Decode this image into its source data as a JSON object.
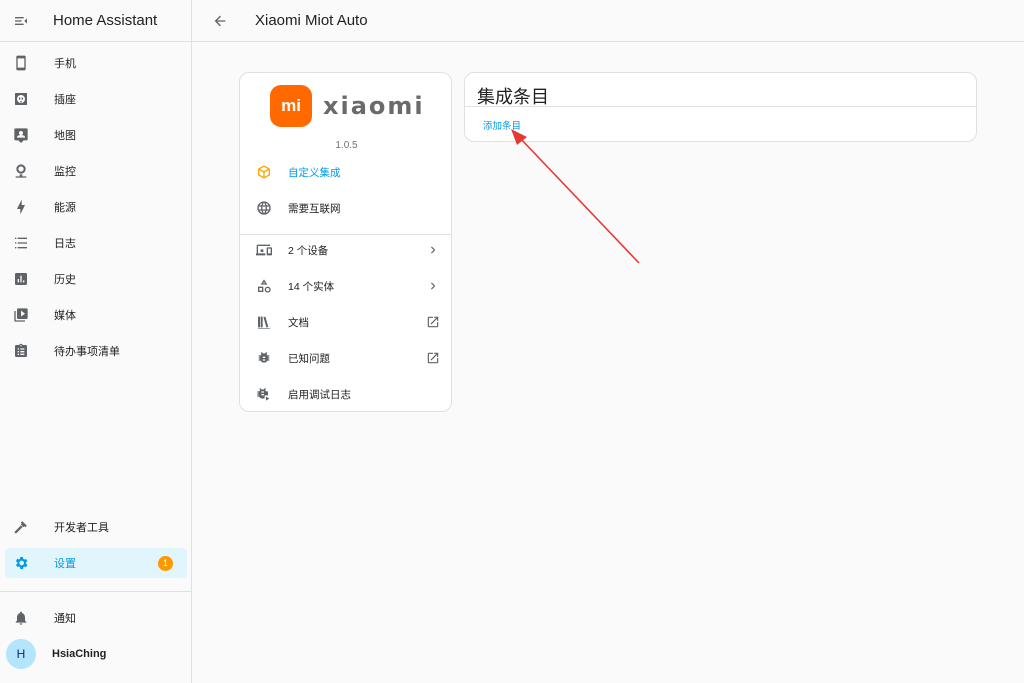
{
  "sidebar": {
    "app_title": "Home Assistant",
    "items": [
      {
        "label": "手机",
        "icon": "phone-icon"
      },
      {
        "label": "插座",
        "icon": "power-socket-icon"
      },
      {
        "label": "地图",
        "icon": "map-icon"
      },
      {
        "label": "监控",
        "icon": "webcam-icon"
      },
      {
        "label": "能源",
        "icon": "lightning-bolt-icon"
      },
      {
        "label": "日志",
        "icon": "list-icon"
      },
      {
        "label": "历史",
        "icon": "chart-box-icon"
      },
      {
        "label": "媒体",
        "icon": "play-box-multiple-icon"
      },
      {
        "label": "待办事项清单",
        "icon": "clipboard-list-icon"
      }
    ],
    "developer_tools": "开发者工具",
    "settings": "设置",
    "settings_badge": "1",
    "notifications": "通知",
    "user_initial": "H",
    "user_name": "HsiaChing"
  },
  "header": {
    "title": "Xiaomi Miot Auto"
  },
  "integration_info": {
    "logo_mark": "mi",
    "logo_text": "xiaomi",
    "version": "1.0.5",
    "custom_integration": "自定义集成",
    "requires_internet": "需要互联网",
    "devices": "2 个设备",
    "entities": "14 个实体",
    "docs": "文档",
    "known_issues": "已知问题",
    "enable_debug": "启用调试日志"
  },
  "entries": {
    "title": "集成条目",
    "add_entry": "添加条目"
  },
  "colors": {
    "accent": "#039be5",
    "xiaomi_orange": "#ff6900",
    "badge": "#ff9800",
    "annotation_arrow": "#e53935"
  }
}
